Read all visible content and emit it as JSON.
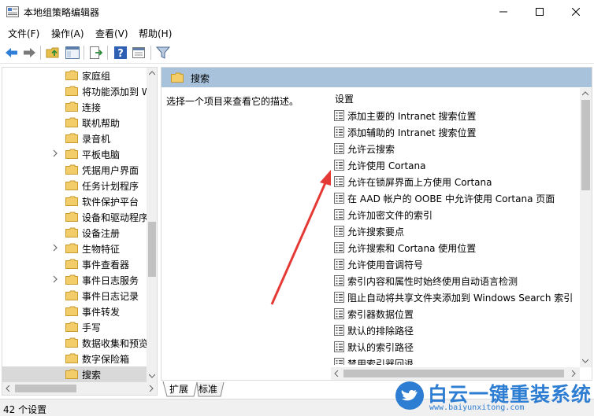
{
  "window": {
    "title": "本地组策略编辑器",
    "controls": [
      "minimize-icon",
      "maximize-icon",
      "close-icon"
    ]
  },
  "menu": {
    "items": [
      "文件(F)",
      "操作(A)",
      "查看(V)",
      "帮助(H)"
    ]
  },
  "toolbar": {
    "icons": [
      "back-arrow-icon",
      "forward-arrow-icon",
      "up-folder-icon",
      "show-hide-tree-icon",
      "export-list-icon",
      "help-icon",
      "properties-icon",
      "filter-icon"
    ]
  },
  "tree": {
    "items": [
      {
        "label": "家庭组",
        "expandable": false
      },
      {
        "label": "将功能添加到 W",
        "expandable": false
      },
      {
        "label": "连接",
        "expandable": false
      },
      {
        "label": "联机帮助",
        "expandable": false
      },
      {
        "label": "录音机",
        "expandable": false
      },
      {
        "label": "平板电脑",
        "expandable": true
      },
      {
        "label": "凭据用户界面",
        "expandable": false
      },
      {
        "label": "任务计划程序",
        "expandable": false
      },
      {
        "label": "软件保护平台",
        "expandable": false
      },
      {
        "label": "设备和驱动程序",
        "expandable": false
      },
      {
        "label": "设备注册",
        "expandable": false
      },
      {
        "label": "生物特征",
        "expandable": true
      },
      {
        "label": "事件查看器",
        "expandable": false
      },
      {
        "label": "事件日志服务",
        "expandable": true
      },
      {
        "label": "事件日志记录",
        "expandable": false
      },
      {
        "label": "事件转发",
        "expandable": false
      },
      {
        "label": "手写",
        "expandable": false
      },
      {
        "label": "数据收集和预览",
        "expandable": false
      },
      {
        "label": "数字保险箱",
        "expandable": false
      },
      {
        "label": "搜索",
        "expandable": false,
        "selected": true
      }
    ]
  },
  "pane": {
    "header": "搜索",
    "description": "选择一个项目来查看它的描述。",
    "column_header": "设置",
    "settings": [
      "添加主要的 Intranet 搜索位置",
      "添加辅助的 Intranet 搜索位置",
      "允许云搜索",
      "允许使用 Cortana",
      "允许在锁屏界面上方使用 Cortana",
      "在 AAD 帐户的 OOBE 中允许使用 Cortana 页面",
      "允许加密文件的索引",
      "允许搜索要点",
      "允许搜索和 Cortana 使用位置",
      "允许使用音调符号",
      "索引内容和属性时始终使用自动语言检测",
      "阻止自动将共享文件夹添加到 Windows Search 索引",
      "索引器数据位置",
      "默认的排除路径",
      "默认的索引路径",
      "禁用索引器回退"
    ]
  },
  "tabs": [
    "扩展",
    "标准"
  ],
  "status": {
    "text": "42 个设置"
  },
  "watermark": {
    "brand": "白云一键重装系统",
    "url": "www.baiyunxitong.com",
    "color": "#2d7dd2"
  },
  "annotation": {
    "color": "#e53935"
  }
}
